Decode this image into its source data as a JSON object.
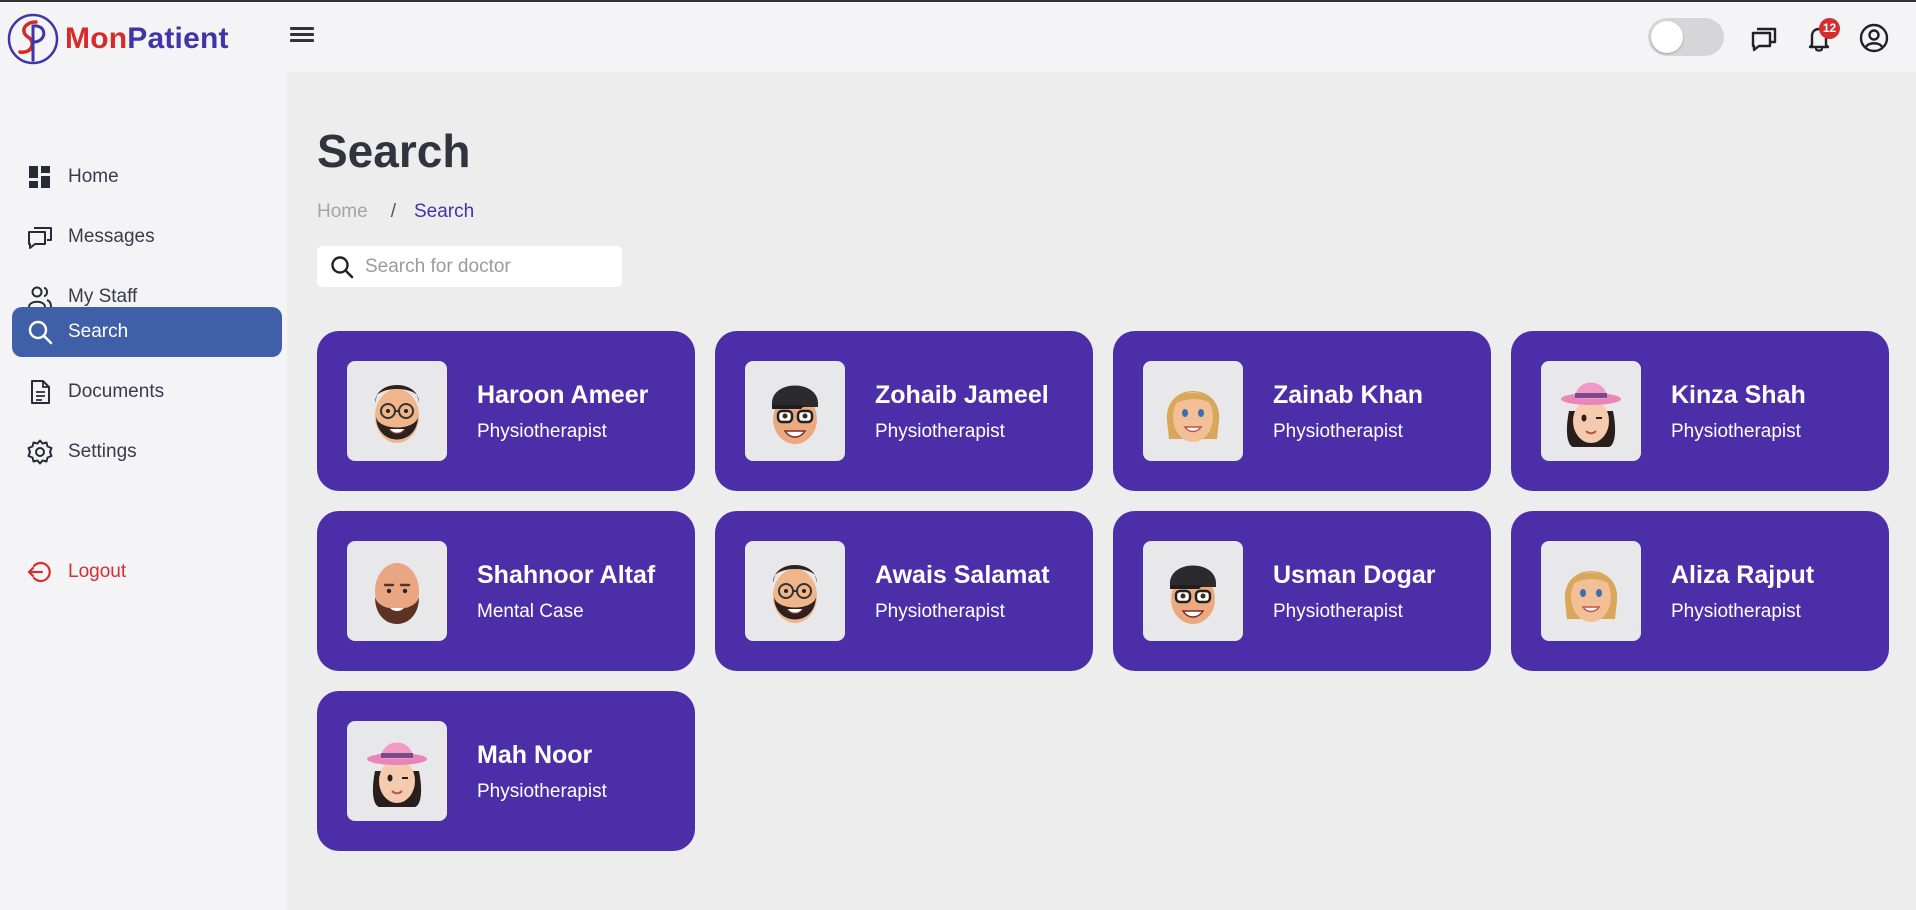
{
  "app": {
    "brand_part1": "Mon",
    "brand_part2": "Patient"
  },
  "header": {
    "notification_count": "12",
    "icons": [
      "menu-icon",
      "toggle-switch",
      "chat-icon",
      "bell-icon",
      "account-icon"
    ]
  },
  "sidebar": {
    "items": [
      {
        "label": "Home",
        "icon": "dashboard-icon"
      },
      {
        "label": "Messages",
        "icon": "messages-icon"
      },
      {
        "label": "My Staff",
        "icon": "staff-icon"
      },
      {
        "label": "Search",
        "icon": "search-icon",
        "active": true
      },
      {
        "label": "Documents",
        "icon": "document-icon"
      },
      {
        "label": "Settings",
        "icon": "gear-icon"
      }
    ],
    "logout_label": "Logout"
  },
  "main": {
    "title": "Search",
    "breadcrumb": {
      "home": "Home",
      "separator": "/",
      "current": "Search"
    },
    "search": {
      "placeholder": "Search for doctor",
      "value": ""
    }
  },
  "doctors": [
    {
      "name": "Haroon Ameer",
      "role": "Physiotherapist",
      "avatar": "bearded-man-glasses"
    },
    {
      "name": "Zohaib Jameel",
      "role": "Physiotherapist",
      "avatar": "man-cap-glasses"
    },
    {
      "name": "Zainab Khan",
      "role": "Physiotherapist",
      "avatar": "blonde-woman"
    },
    {
      "name": "Kinza Shah",
      "role": "Physiotherapist",
      "avatar": "woman-pink-hat"
    },
    {
      "name": "Shahnoor Altaf",
      "role": "Mental Case",
      "avatar": "bald-bearded-man"
    },
    {
      "name": "Awais Salamat",
      "role": "Physiotherapist",
      "avatar": "bearded-man-glasses"
    },
    {
      "name": "Usman Dogar",
      "role": "Physiotherapist",
      "avatar": "man-cap-glasses"
    },
    {
      "name": "Aliza Rajput",
      "role": "Physiotherapist",
      "avatar": "blonde-woman"
    },
    {
      "name": "Mah Noor",
      "role": "Physiotherapist",
      "avatar": "woman-pink-hat"
    }
  ],
  "colors": {
    "card_bg": "#4c2fa8",
    "active_nav": "#3f5fa8",
    "logout": "#d32f2f",
    "brand_red": "#d62b2b",
    "brand_blue": "#3f35a6"
  }
}
